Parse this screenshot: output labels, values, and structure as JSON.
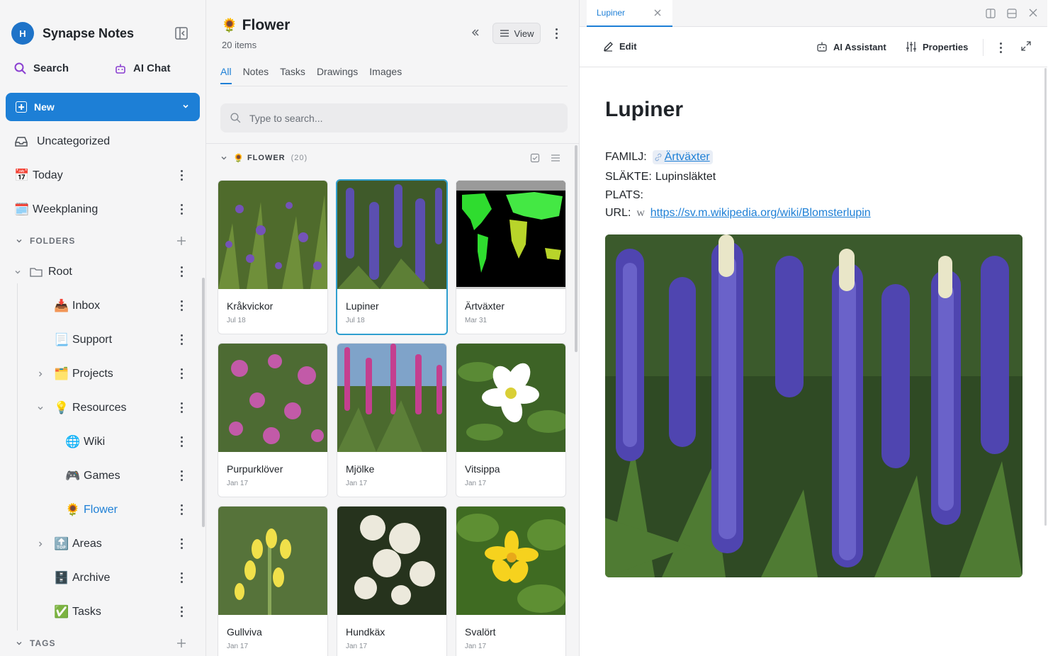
{
  "sidebar": {
    "avatar_initial": "H",
    "app_name": "Synapse Notes",
    "search_label": "Search",
    "ai_chat_label": "AI Chat",
    "new_label": "New",
    "items": [
      {
        "label": "Uncategorized",
        "icon": "inbox-tray-icon"
      },
      {
        "label": "Today",
        "emoji": "📅"
      },
      {
        "label": "Weekplaning",
        "emoji": "🗓️"
      }
    ],
    "folders_header": "FOLDERS",
    "root_label": "Root",
    "tree": [
      {
        "label": "Inbox",
        "emoji": "📥"
      },
      {
        "label": "Support",
        "emoji": "📃"
      },
      {
        "label": "Projects",
        "emoji": "🗂️"
      },
      {
        "label": "Resources",
        "emoji": "💡"
      },
      {
        "label": "Wiki",
        "emoji": "🌐"
      },
      {
        "label": "Games",
        "emoji": "🎮"
      },
      {
        "label": "Flower",
        "emoji": "🌻"
      },
      {
        "label": "Areas",
        "emoji": "🔝"
      },
      {
        "label": "Archive",
        "emoji": "🗄️"
      },
      {
        "label": "Tasks",
        "emoji": "✅"
      }
    ],
    "tags_header": "TAGS"
  },
  "list": {
    "title_emoji": "🌻",
    "title": "Flower",
    "count": "20 items",
    "view_label": "View",
    "tabs": [
      "All",
      "Notes",
      "Tasks",
      "Drawings",
      "Images"
    ],
    "active_tab": "All",
    "search_placeholder": "Type to search...",
    "group_emoji": "🌻",
    "group_label": "FLOWER",
    "group_count": "(20)",
    "cards": [
      {
        "name": "Kråkvickor",
        "date": "Jul 18"
      },
      {
        "name": "Lupiner",
        "date": "Jul 18"
      },
      {
        "name": "Ärtväxter",
        "date": "Mar 31"
      },
      {
        "name": "Purpurklöver",
        "date": "Jan 17"
      },
      {
        "name": "Mjölke",
        "date": "Jan 17"
      },
      {
        "name": "Vitsippa",
        "date": "Jan 17"
      },
      {
        "name": "Gullviva",
        "date": "Jan 17"
      },
      {
        "name": "Hundkäx",
        "date": "Jan 17"
      },
      {
        "name": "Svalört",
        "date": "Jan 17"
      }
    ]
  },
  "detail": {
    "tab_label": "Lupiner",
    "edit_label": "Edit",
    "ai_assistant_label": "AI Assistant",
    "properties_label": "Properties",
    "title": "Lupiner",
    "familj_label": "FAMILJ:",
    "familj_value": "Ärtväxter",
    "slakte_label": "SLÄKTE:",
    "slakte_value": "Lupinsläktet",
    "plats_label": "PLATS:",
    "url_label": "URL:",
    "url_value": "https://sv.m.wikipedia.org/wiki/Blomsterlupin",
    "wiki_glyph": "W"
  },
  "colors": {
    "accent": "#1d7fd6",
    "selected_card": "#2f9fcf"
  }
}
